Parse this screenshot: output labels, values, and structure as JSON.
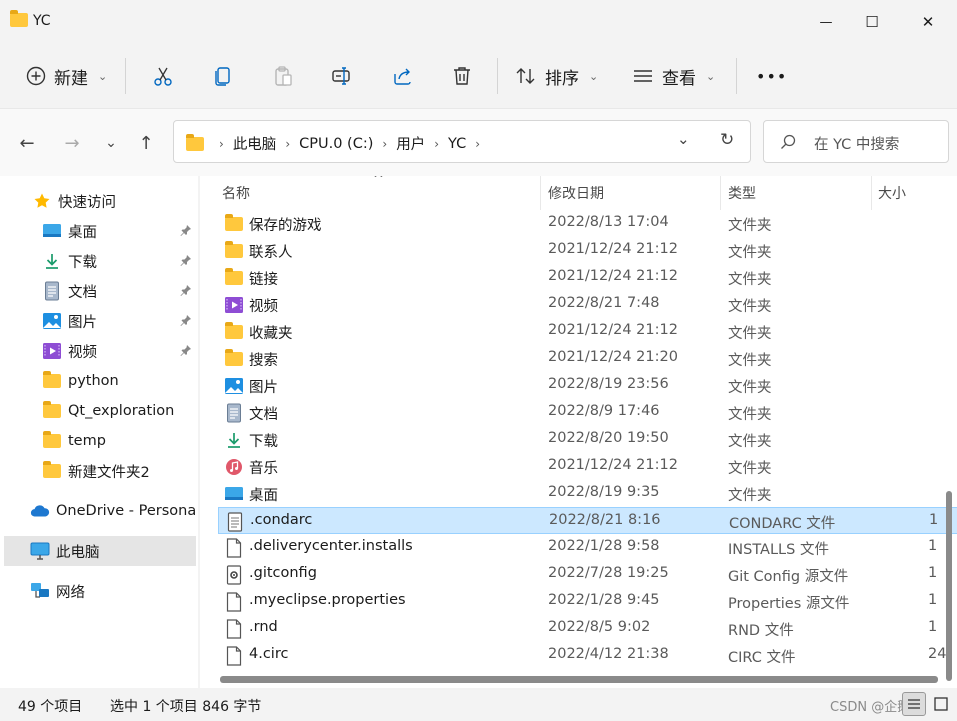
{
  "window": {
    "title": "YC",
    "minimize_glyph": "—",
    "maximize_glyph": "☐",
    "close_glyph": "✕"
  },
  "toolbar": {
    "new_label": "新建",
    "sort_label": "排序",
    "view_label": "查看",
    "more_label": "•••",
    "icons": [
      "plus-circle-icon",
      "cut-icon",
      "copy-icon",
      "paste-icon",
      "rename-icon",
      "share-icon",
      "delete-icon",
      "sort-icon",
      "view-icon",
      "more-icon"
    ]
  },
  "nav": {
    "back_glyph": "←",
    "forward_glyph": "→",
    "recent_glyph": "⌄",
    "up_glyph": "↑",
    "breadcrumb": [
      "此电脑",
      "CPU.0 (C:)",
      "用户",
      "YC"
    ],
    "crumb_sep": "›",
    "dropdown_glyph": "⌄",
    "refresh_glyph": "↻",
    "search_placeholder": "在 YC 中搜索"
  },
  "sidebar": {
    "items": [
      {
        "label": "快速访问",
        "icon": "star-icon"
      },
      {
        "label": "桌面",
        "icon": "desktop-icon",
        "pinned": true
      },
      {
        "label": "下载",
        "icon": "download-icon",
        "pinned": true
      },
      {
        "label": "文档",
        "icon": "document-icon",
        "pinned": true
      },
      {
        "label": "图片",
        "icon": "pictures-icon",
        "pinned": true
      },
      {
        "label": "视频",
        "icon": "videos-icon",
        "pinned": true
      },
      {
        "label": "python",
        "icon": "folder-icon"
      },
      {
        "label": "Qt_exploration",
        "icon": "folder-icon"
      },
      {
        "label": "temp",
        "icon": "folder-icon"
      },
      {
        "label": "新建文件夹2",
        "icon": "folder-icon"
      },
      {
        "label": "OneDrive - Persona",
        "icon": "onedrive-icon"
      },
      {
        "label": "此电脑",
        "icon": "this-pc-icon",
        "selected": true
      },
      {
        "label": "网络",
        "icon": "network-icon"
      }
    ]
  },
  "columns": {
    "name": "名称",
    "date": "修改日期",
    "type": "类型",
    "size": "大小",
    "sort_glyph": "^"
  },
  "files": [
    {
      "name": "保存的游戏",
      "date": "2022/8/13 17:04",
      "type": "文件夹",
      "size": "",
      "icon": "folder-icon"
    },
    {
      "name": "联系人",
      "date": "2021/12/24 21:12",
      "type": "文件夹",
      "size": "",
      "icon": "folder-icon"
    },
    {
      "name": "链接",
      "date": "2021/12/24 21:12",
      "type": "文件夹",
      "size": "",
      "icon": "folder-icon"
    },
    {
      "name": "视频",
      "date": "2022/8/21 7:48",
      "type": "文件夹",
      "size": "",
      "icon": "videos-icon"
    },
    {
      "name": "收藏夹",
      "date": "2021/12/24 21:12",
      "type": "文件夹",
      "size": "",
      "icon": "folder-icon"
    },
    {
      "name": "搜索",
      "date": "2021/12/24 21:20",
      "type": "文件夹",
      "size": "",
      "icon": "folder-icon"
    },
    {
      "name": "图片",
      "date": "2022/8/19 23:56",
      "type": "文件夹",
      "size": "",
      "icon": "pictures-icon"
    },
    {
      "name": "文档",
      "date": "2022/8/9 17:46",
      "type": "文件夹",
      "size": "",
      "icon": "document-icon"
    },
    {
      "name": "下载",
      "date": "2022/8/20 19:50",
      "type": "文件夹",
      "size": "",
      "icon": "download-icon"
    },
    {
      "name": "音乐",
      "date": "2021/12/24 21:12",
      "type": "文件夹",
      "size": "",
      "icon": "music-icon"
    },
    {
      "name": "桌面",
      "date": "2022/8/19 9:35",
      "type": "文件夹",
      "size": "",
      "icon": "desktop-icon"
    },
    {
      "name": ".condarc",
      "date": "2022/8/21 8:16",
      "type": "CONDARC 文件",
      "size": "1",
      "icon": "text-file-icon",
      "selected": true
    },
    {
      "name": ".deliverycenter.installs",
      "date": "2022/1/28 9:58",
      "type": "INSTALLS 文件",
      "size": "1",
      "icon": "file-icon"
    },
    {
      "name": ".gitconfig",
      "date": "2022/7/28 19:25",
      "type": "Git Config 源文件",
      "size": "1",
      "icon": "config-file-icon"
    },
    {
      "name": ".myeclipse.properties",
      "date": "2022/1/28 9:45",
      "type": "Properties 源文件",
      "size": "1",
      "icon": "file-icon"
    },
    {
      "name": ".rnd",
      "date": "2022/8/5 9:02",
      "type": "RND 文件",
      "size": "1",
      "icon": "file-icon"
    },
    {
      "name": "4.circ",
      "date": "2022/4/12 21:38",
      "type": "CIRC 文件",
      "size": "24",
      "icon": "file-icon"
    }
  ],
  "status": {
    "item_count": "49 个项目",
    "selection": "选中 1 个项目  846 字节",
    "watermark": "CSDN @企鹅75"
  },
  "colors": {
    "accent": "#0067c0",
    "selection_bg": "#cce8ff",
    "folder": "#ffc83d"
  }
}
